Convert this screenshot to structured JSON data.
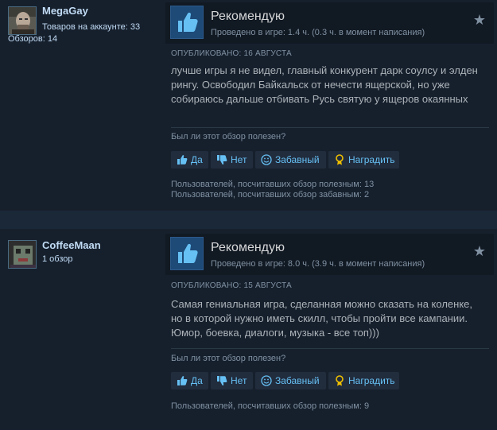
{
  "reviews": [
    {
      "author": "MegaGay",
      "author_products": "Товаров на аккаунте: 33",
      "author_reviews": "Обзоров: 14",
      "verdict": "Рекомендую",
      "hours": "Проведено в игре: 1.4 ч. (0.3 ч. в момент написания)",
      "posted": "ОПУБЛИКОВАНО: 16 АВГУСТА",
      "text": "лучше игры я не видел, главный конкурент дарк соулсу и элден рингу. Освободил Байкальск от нечести ящерской, но уже собираюсь дальше отбивать Русь святую у ящеров окаянных",
      "helpful_question": "Был ли этот обзор полезен?",
      "buttons": {
        "yes": "Да",
        "no": "Нет",
        "funny": "Забавный",
        "award": "Наградить"
      },
      "stats": [
        "Пользователей, посчитавших обзор полезным: 13",
        "Пользователей, посчитавших обзор забавным: 2"
      ]
    },
    {
      "author": "CoffeeMaan",
      "author_products": "1 обзор",
      "author_reviews": "",
      "verdict": "Рекомендую",
      "hours": "Проведено в игре: 8.0 ч. (3.9 ч. в момент написания)",
      "posted": "ОПУБЛИКОВАНО: 15 АВГУСТА",
      "text": "Самая гениальная игра, сделанная можно сказать на коленке, но в которой нужно иметь скилл, чтобы пройти все кампании. Юмор, боевка, диалоги, музыка - все топ)))",
      "helpful_question": "Был ли этот обзор полезен?",
      "buttons": {
        "yes": "Да",
        "no": "Нет",
        "funny": "Забавный",
        "award": "Наградить"
      },
      "stats": [
        "Пользователей, посчитавших обзор полезным: 9"
      ]
    }
  ],
  "icons": {
    "recommend": "thumbs-up-icon",
    "favorite": "star-icon",
    "yes": "thumbs-up-icon",
    "no": "thumbs-down-icon",
    "funny": "smiley-icon",
    "award": "award-icon"
  },
  "colors": {
    "page_bg": "#1b2838",
    "card_bg": "#16202d",
    "link": "#66c0f4",
    "author": "#c1dbf4",
    "muted": "#8091a2",
    "text": "#acb2b8"
  }
}
